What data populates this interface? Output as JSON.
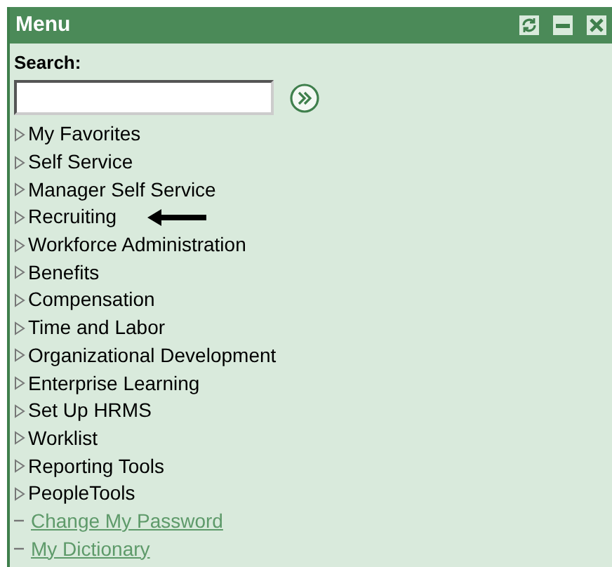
{
  "window": {
    "title": "Menu"
  },
  "search": {
    "label": "Search:"
  },
  "items": [
    {
      "kind": "folder",
      "label": "My Favorites",
      "pointed": false
    },
    {
      "kind": "folder",
      "label": "Self Service",
      "pointed": false
    },
    {
      "kind": "folder",
      "label": "Manager Self Service",
      "pointed": false
    },
    {
      "kind": "folder",
      "label": "Recruiting",
      "pointed": true
    },
    {
      "kind": "folder",
      "label": "Workforce Administration",
      "pointed": false
    },
    {
      "kind": "folder",
      "label": "Benefits",
      "pointed": false
    },
    {
      "kind": "folder",
      "label": "Compensation",
      "pointed": false
    },
    {
      "kind": "folder",
      "label": "Time and Labor",
      "pointed": false
    },
    {
      "kind": "folder",
      "label": "Organizational Development",
      "pointed": false
    },
    {
      "kind": "folder",
      "label": "Enterprise Learning",
      "pointed": false
    },
    {
      "kind": "folder",
      "label": "Set Up HRMS",
      "pointed": false
    },
    {
      "kind": "folder",
      "label": "Worklist",
      "pointed": false
    },
    {
      "kind": "folder",
      "label": "Reporting Tools",
      "pointed": false
    },
    {
      "kind": "folder",
      "label": "PeopleTools",
      "pointed": false
    },
    {
      "kind": "link",
      "label": "Change My Password",
      "pointed": false
    },
    {
      "kind": "link",
      "label": "My Dictionary",
      "pointed": false
    }
  ]
}
